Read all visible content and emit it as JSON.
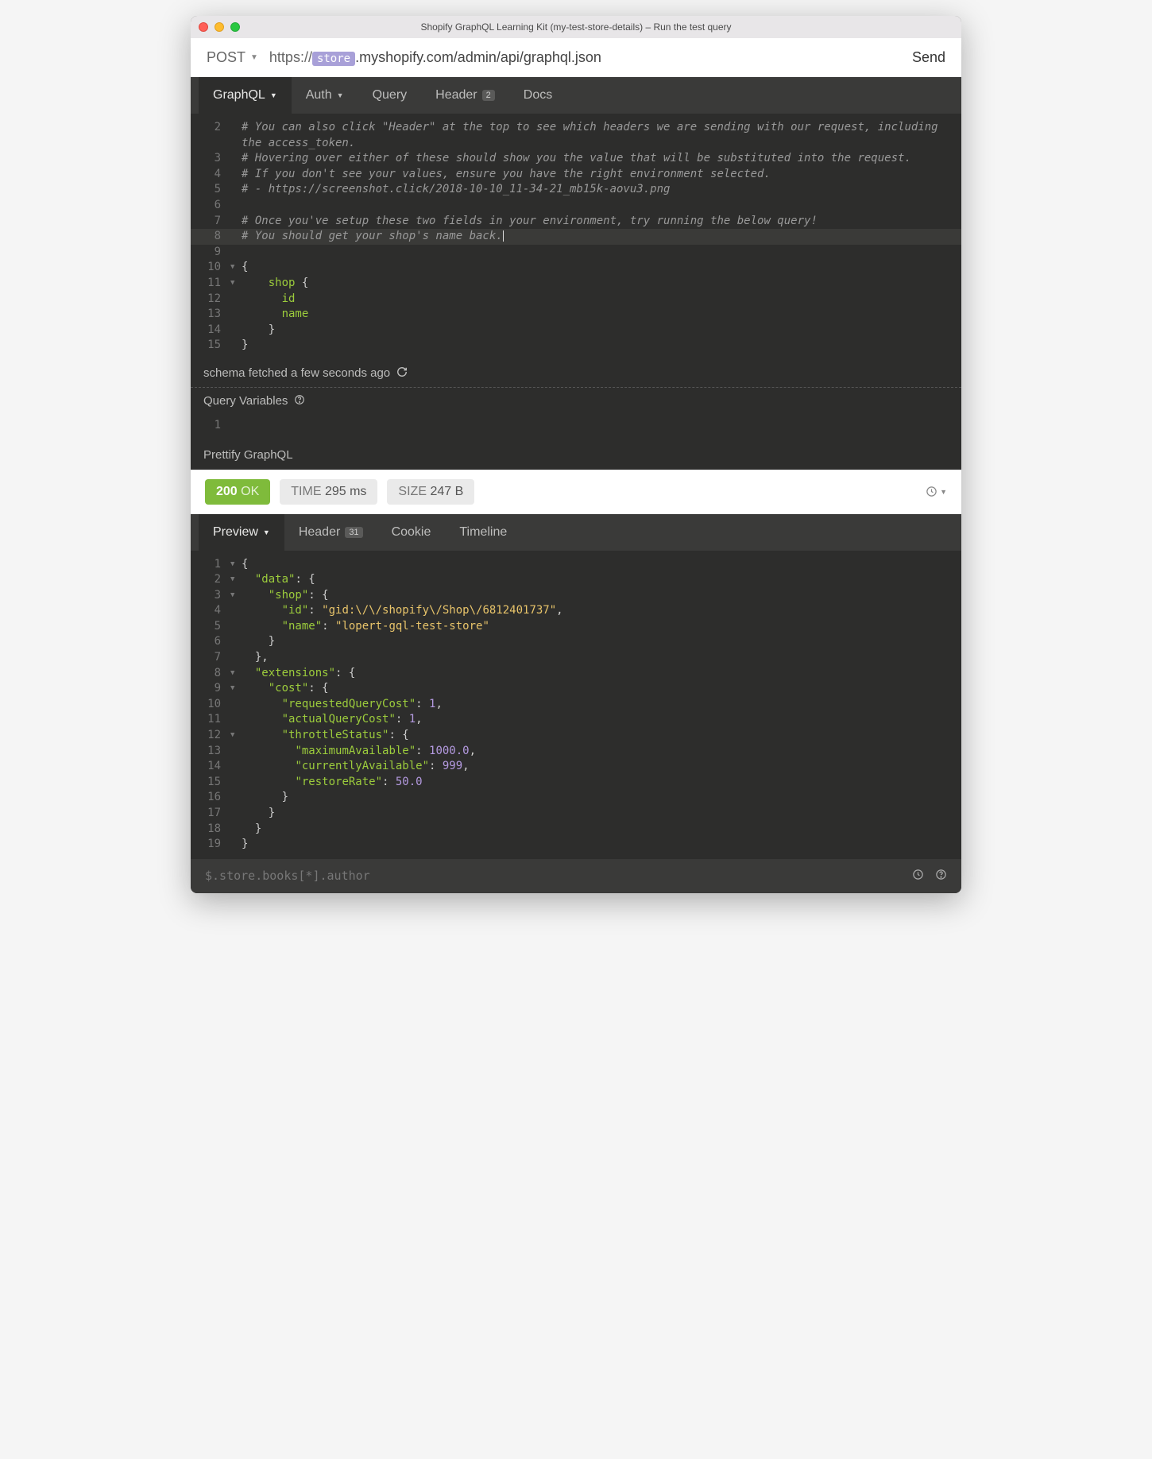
{
  "window": {
    "title": "Shopify GraphQL Learning Kit (my-test-store-details) – Run the test query"
  },
  "request": {
    "method": "POST",
    "url_prefix": "https://",
    "url_var": "store",
    "url_rest": ".myshopify.com/admin/api/graphql.json",
    "send_label": "Send"
  },
  "req_tabs": {
    "graphql": "GraphQL",
    "auth": "Auth",
    "query": "Query",
    "header": "Header",
    "header_badge": "2",
    "docs": "Docs"
  },
  "editor_lines": [
    {
      "n": 2,
      "type": "comment",
      "text": "# You can also click \"Header\" at the top to see which headers we are sending with our request, including the access_token."
    },
    {
      "n": 3,
      "type": "comment",
      "text": "# Hovering over either of these should show you the value that will be substituted into the request."
    },
    {
      "n": 4,
      "type": "comment",
      "text": "# If you don't see your values, ensure you have the right environment selected."
    },
    {
      "n": 5,
      "type": "comment",
      "text": "# - https://screenshot.click/2018-10-10_11-34-21_mb15k-aovu3.png"
    },
    {
      "n": 6,
      "type": "blank",
      "text": ""
    },
    {
      "n": 7,
      "type": "comment",
      "text": "# Once you've setup these two fields in your environment, try running the below query!"
    },
    {
      "n": 8,
      "type": "comment",
      "text": "# You should get your shop's name back.",
      "cursor": true,
      "hl": true
    },
    {
      "n": 9,
      "type": "blank",
      "text": ""
    },
    {
      "n": 10,
      "type": "brace",
      "text": "{",
      "fold": true
    },
    {
      "n": 11,
      "type": "kw",
      "text": "    shop {",
      "fold": true
    },
    {
      "n": 12,
      "type": "kw2",
      "text": "      id"
    },
    {
      "n": 13,
      "type": "kw2",
      "text": "      name"
    },
    {
      "n": 14,
      "type": "brace",
      "text": "    }"
    },
    {
      "n": 15,
      "type": "brace",
      "text": "}"
    }
  ],
  "schema_status": "schema fetched a few seconds ago",
  "query_variables": "Query Variables",
  "qvar_line": "1",
  "prettify": "Prettify GraphQL",
  "response": {
    "status_code": "200",
    "status_text": "OK",
    "time_label": "TIME",
    "time_value": "295 ms",
    "size_label": "SIZE",
    "size_value": "247 B"
  },
  "resp_tabs": {
    "preview": "Preview",
    "header": "Header",
    "header_badge": "31",
    "cookie": "Cookie",
    "timeline": "Timeline"
  },
  "response_json": {
    "data": {
      "shop": {
        "id": "gid:\\/\\/shopify\\/Shop\\/6812401737",
        "name": "lopert-gql-test-store"
      }
    },
    "extensions": {
      "cost": {
        "requestedQueryCost": 1,
        "actualQueryCost": 1,
        "throttleStatus": {
          "maximumAvailable": 1000.0,
          "currentlyAvailable": 999,
          "restoreRate": 50.0
        }
      }
    }
  },
  "footer": {
    "path_hint": "$.store.books[*].author"
  }
}
